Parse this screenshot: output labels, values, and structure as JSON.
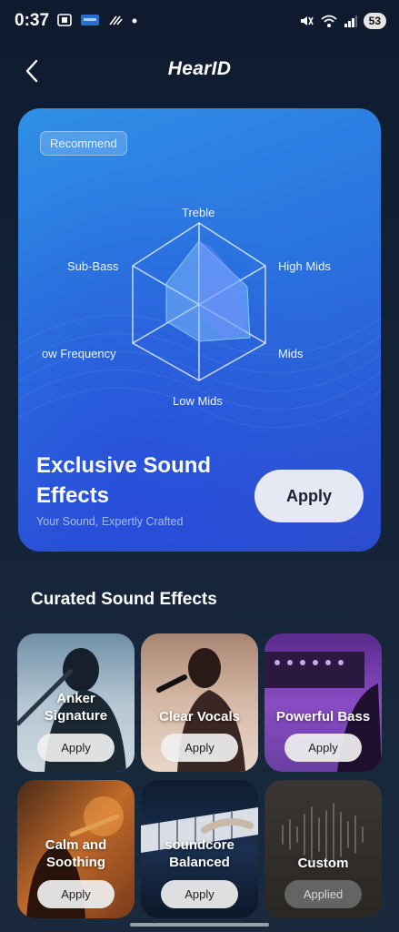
{
  "status_bar": {
    "time": "0:37",
    "battery": "53"
  },
  "header": {
    "title": "HearID"
  },
  "hero": {
    "badge": "Recommend",
    "radar_axes": [
      "Treble",
      "High Mids",
      "Mids",
      "Low Mids",
      "ow Frequency",
      "Sub-Bass"
    ],
    "title": "Exclusive Sound Effects",
    "subtitle": "Your Sound, Expertly Crafted",
    "apply_label": "Apply"
  },
  "section": {
    "title": "Curated Sound Effects"
  },
  "tiles": [
    {
      "label": "Anker\nSignature",
      "button": "Apply"
    },
    {
      "label": "Clear Vocals",
      "button": "Apply"
    },
    {
      "label": "Powerful Bass",
      "button": "Apply"
    },
    {
      "label": "Calm and\nSoothing",
      "button": "Apply"
    },
    {
      "label": "soundcore\nBalanced",
      "button": "Apply"
    },
    {
      "label": "Custom",
      "button": "Applied"
    }
  ],
  "colors": {
    "hero_top": "#2f8fe6",
    "hero_bottom": "#2c4bd0",
    "page_bg": "#142238"
  }
}
